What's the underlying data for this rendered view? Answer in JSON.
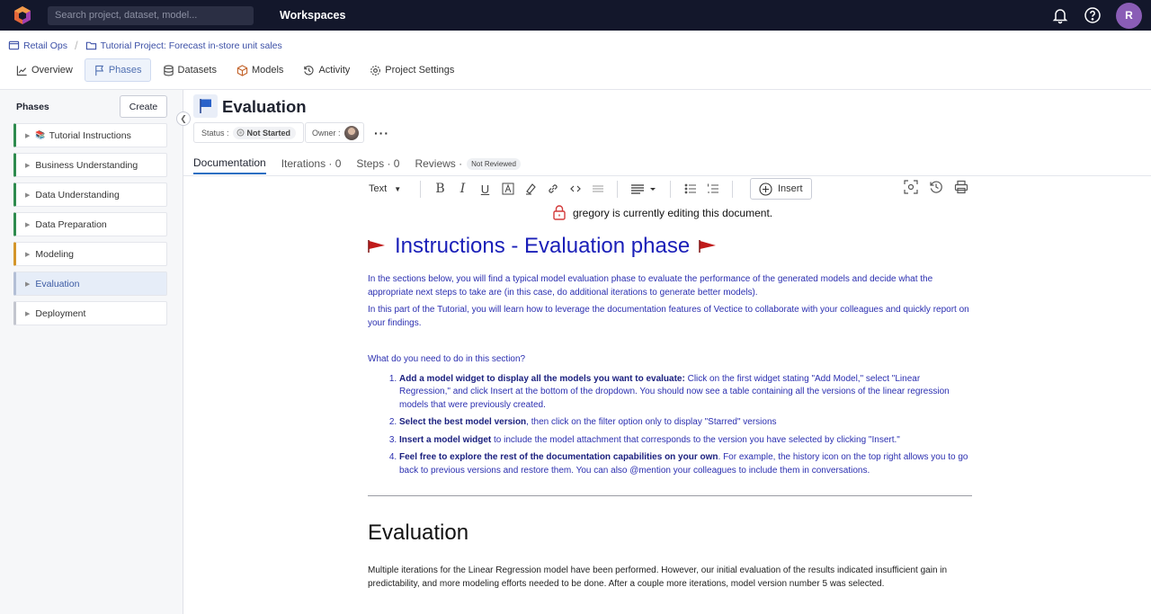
{
  "topbar": {
    "search_placeholder": "Search project, dataset, model...",
    "workspace_title": "Workspaces",
    "avatar_initial": "R"
  },
  "breadcrumb": {
    "workspace": "Retail Ops",
    "project": "Tutorial Project: Forecast in-store unit sales"
  },
  "nav": {
    "items": [
      "Overview",
      "Phases",
      "Datasets",
      "Models",
      "Activity",
      "Project Settings"
    ],
    "active": "Phases"
  },
  "sidebar": {
    "title": "Phases",
    "create_label": "Create",
    "phases": [
      {
        "label": "Tutorial Instructions",
        "emoji": "📚"
      },
      {
        "label": "Business Understanding"
      },
      {
        "label": "Data Understanding"
      },
      {
        "label": "Data Preparation"
      },
      {
        "label": "Modeling"
      },
      {
        "label": "Evaluation"
      },
      {
        "label": "Deployment"
      }
    ]
  },
  "phase": {
    "title": "Evaluation",
    "status_label": "Status :",
    "status_value": "Not Started",
    "owner_label": "Owner :",
    "more": "···"
  },
  "tabs": {
    "documentation": "Documentation",
    "iterations": "Iterations · 0",
    "steps": "Steps · 0",
    "reviews": "Reviews ·",
    "reviews_badge": "Not Reviewed"
  },
  "toolbar": {
    "text_style": "Text",
    "insert_label": "Insert"
  },
  "lock_message": "gregory is currently editing this document.",
  "document": {
    "h1": "Instructions - Evaluation phase",
    "p1": "In the sections below, you will find a typical model evaluation phase to evaluate the performance of the generated models and decide what the appropriate next steps to take are (in this case, do additional iterations to generate better models).",
    "p2": "In this part of the Tutorial, you will learn how to leverage the documentation features of Vectice to collaborate with your colleagues and quickly report on your findings.",
    "question": "What do you need to do in this section?",
    "steps": [
      {
        "bold": "Add a model widget to display all the models you want to evaluate:",
        "rest": " Click on the first widget stating \"Add Model,\" select \"Linear Regression,\" and click Insert at the bottom of the dropdown. You should now see a table containing all the versions of the linear regression models that were previously created."
      },
      {
        "bold": "Select the best model version",
        "rest": ", then click on the filter option only to display \"Starred\" versions"
      },
      {
        "bold": "Insert a model widget",
        "rest": " to include the model attachment that corresponds to the version you have selected by clicking \"Insert.\""
      },
      {
        "bold": "Feel free to explore the rest of the documentation capabilities on your own",
        "rest": ". For example, the history icon on the top right allows you to go back to previous versions and restore them. You can also @mention your colleagues to include them in conversations."
      }
    ],
    "h2": "Evaluation",
    "p3": "Multiple iterations for the Linear Regression model have been performed. However, our initial evaluation of the results indicated insufficient gain in predictability, and more modeling efforts needed to be done. After a couple more iterations, model version number 5 was selected."
  }
}
